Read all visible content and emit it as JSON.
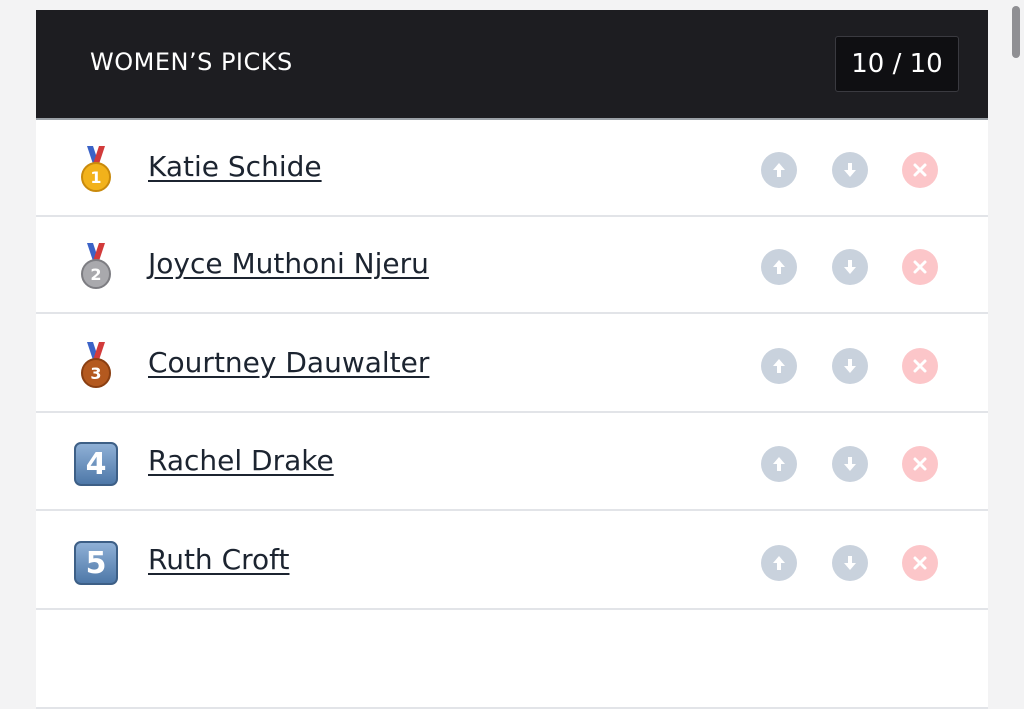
{
  "header": {
    "title": "WOMEN’S PICKS",
    "counter": "10 / 10"
  },
  "picks": [
    {
      "rank_badge": "gold-medal",
      "name": "Katie Schide"
    },
    {
      "rank_badge": "silver-medal",
      "name": "Joyce Muthoni Njeru"
    },
    {
      "rank_badge": "bronze-medal",
      "name": "Courtney Dauwalter"
    },
    {
      "rank_badge": "keycap",
      "rank": "4",
      "name": "Rachel Drake"
    },
    {
      "rank_badge": "keycap",
      "rank": "5",
      "name": "Ruth Croft"
    }
  ],
  "actions": {
    "up_icon": "arrow-up-circle-icon",
    "down_icon": "arrow-down-circle-icon",
    "remove_icon": "x-circle-icon"
  },
  "colors": {
    "header_bg": "#1d1d21",
    "move_button": "#c9d2dd",
    "remove_button": "#fcc6c9",
    "gold": "#f2b21b",
    "silver": "#a9a9ad",
    "bronze": "#b4591f"
  }
}
